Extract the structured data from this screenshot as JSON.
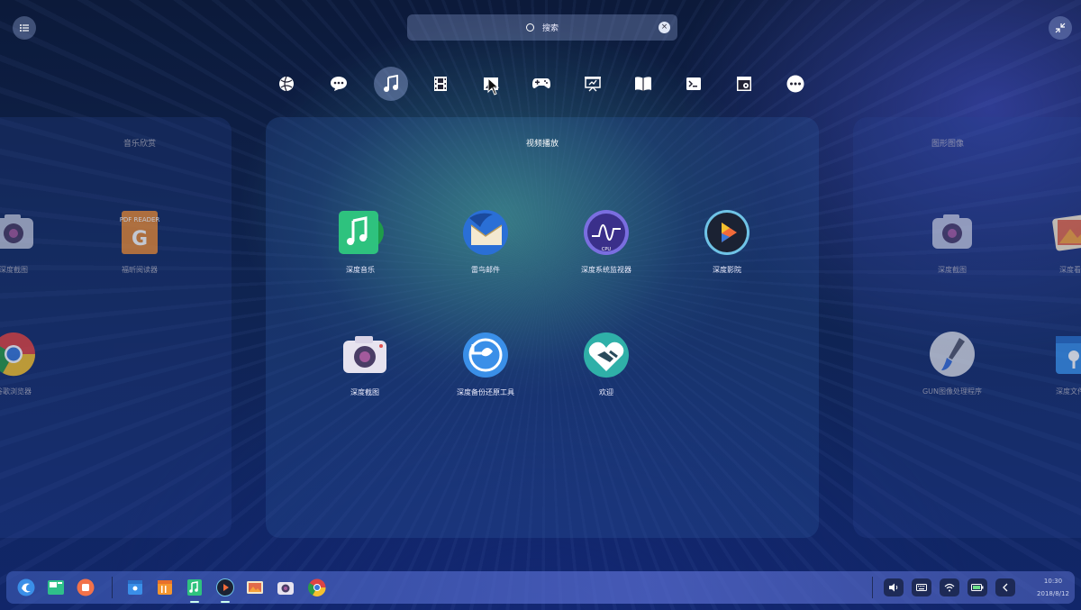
{
  "search": {
    "placeholder": "搜索"
  },
  "categories": [
    {
      "name": "internet",
      "icon": "globe-icon"
    },
    {
      "name": "chat",
      "icon": "chat-icon"
    },
    {
      "name": "music",
      "icon": "music-note-icon",
      "active": true
    },
    {
      "name": "video",
      "icon": "film-icon"
    },
    {
      "name": "graphics",
      "icon": "image-icon"
    },
    {
      "name": "game",
      "icon": "gamepad-icon"
    },
    {
      "name": "office",
      "icon": "presentation-icon"
    },
    {
      "name": "reading",
      "icon": "book-icon"
    },
    {
      "name": "development",
      "icon": "terminal-icon"
    },
    {
      "name": "system",
      "icon": "window-gear-icon"
    },
    {
      "name": "others",
      "icon": "more-icon"
    }
  ],
  "pages": {
    "left": {
      "title": "音乐欣赏",
      "apps": [
        {
          "label": "深度截图",
          "icon": "camera-icon"
        },
        {
          "label": "福昕阅读器",
          "icon": "pdf-reader-icon"
        },
        {
          "label": "谷歌浏览器",
          "icon": "chrome-icon"
        }
      ]
    },
    "center": {
      "title": "视频播放",
      "apps": [
        {
          "label": "深度音乐",
          "icon": "deepin-music-icon"
        },
        {
          "label": "雷鸟邮件",
          "icon": "thunderbird-icon"
        },
        {
          "label": "深度系统监视器",
          "icon": "system-monitor-icon"
        },
        {
          "label": "深度影院",
          "icon": "movie-player-icon"
        },
        {
          "label": "深度截图",
          "icon": "screenshot-icon"
        },
        {
          "label": "深度备份还原工具",
          "icon": "backup-restore-icon"
        },
        {
          "label": "欢迎",
          "icon": "welcome-handshake-icon"
        }
      ]
    },
    "right": {
      "title": "图形图像",
      "apps": [
        {
          "label": "深度截图",
          "icon": "camera-icon"
        },
        {
          "label": "深度看图",
          "icon": "image-viewer-icon"
        },
        {
          "label": "GUN图像处理程序",
          "icon": "gimp-icon"
        },
        {
          "label": "深度文件管",
          "icon": "file-manager-icon"
        }
      ]
    }
  },
  "monitor_cpu_label": "CPU",
  "pdf_icon_text": "PDF READER",
  "pdf_icon_letter": "G",
  "tray": {
    "time": "10:30",
    "date": "2018/8/12"
  },
  "colors": {
    "accent": "#4a7bd8",
    "dock_bg": "#4b63b8"
  }
}
